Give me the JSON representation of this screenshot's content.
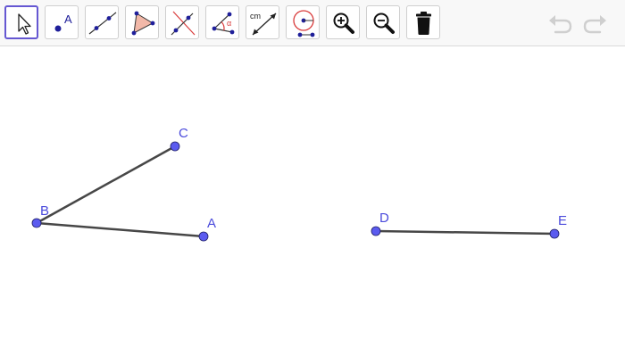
{
  "toolbar": {
    "tools": [
      {
        "name": "move-tool",
        "icon": "arrow-cursor-icon",
        "selected": true
      },
      {
        "name": "point-tool",
        "icon": "point-icon",
        "label": "A"
      },
      {
        "name": "line-tool",
        "icon": "line-icon"
      },
      {
        "name": "polygon-tool",
        "icon": "polygon-icon"
      },
      {
        "name": "perpendicular-line-tool",
        "icon": "perpendicular-icon"
      },
      {
        "name": "angle-tool",
        "icon": "angle-icon",
        "label": "α"
      },
      {
        "name": "distance-tool",
        "icon": "distance-icon",
        "label": "cm"
      },
      {
        "name": "circle-tool",
        "icon": "circle-icon"
      },
      {
        "name": "zoom-in-tool",
        "icon": "zoom-in-icon"
      },
      {
        "name": "zoom-out-tool",
        "icon": "zoom-out-icon"
      },
      {
        "name": "delete-tool",
        "icon": "trash-icon"
      }
    ],
    "undo_icon": "undo-icon",
    "redo_icon": "redo-icon"
  },
  "colors": {
    "point_fill": "#5b5bef",
    "point_label": "#4b4bdc",
    "segment": "#474747",
    "selected_border": "#6557d2",
    "icon_disabled": "#d2d2d2"
  },
  "graphics": {
    "points": {
      "A": {
        "label": "A"
      },
      "B": {
        "label": "B"
      },
      "C": {
        "label": "C"
      },
      "D": {
        "label": "D"
      },
      "E": {
        "label": "E"
      }
    },
    "segments": [
      {
        "from": "B",
        "to": "C"
      },
      {
        "from": "B",
        "to": "A"
      },
      {
        "from": "D",
        "to": "E"
      }
    ]
  }
}
